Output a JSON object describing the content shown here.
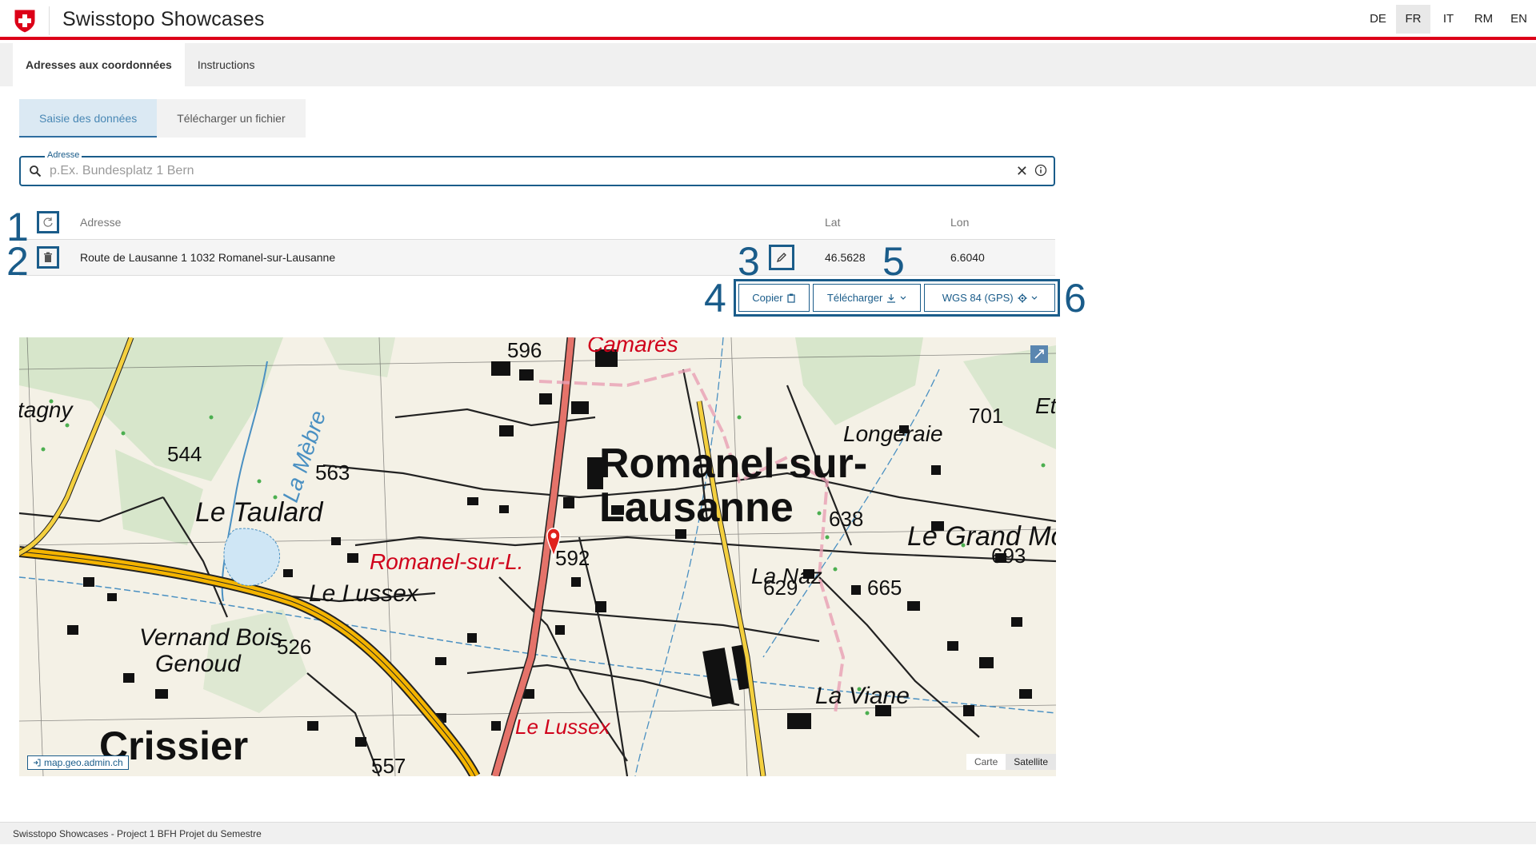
{
  "header": {
    "title": "Swisstopo Showcases",
    "languages": [
      "DE",
      "FR",
      "IT",
      "RM",
      "EN"
    ],
    "active_language": "FR"
  },
  "top_tabs": [
    {
      "label": "Adresses aux coordonnées",
      "active": true
    },
    {
      "label": "Instructions",
      "active": false
    }
  ],
  "sub_tabs": [
    {
      "label": "Saisie des données",
      "active": true
    },
    {
      "label": "Télécharger un fichier",
      "active": false
    }
  ],
  "address_field": {
    "legend": "Adresse",
    "value": "",
    "placeholder": "p.Ex. Bundesplatz 1 Bern"
  },
  "table": {
    "headers": {
      "address": "Adresse",
      "lat": "Lat",
      "lon": "Lon"
    },
    "rows": [
      {
        "address": "Route de Lausanne 1 1032 Romanel-sur-Lausanne",
        "lat": "46.5628",
        "lon": "6.6040"
      }
    ]
  },
  "annotations": [
    "1",
    "2",
    "3",
    "4",
    "5",
    "6"
  ],
  "actions": {
    "copy": "Copier",
    "download": "Télécharger",
    "crs": "WGS 84 (GPS)"
  },
  "map": {
    "attribution": "map.geo.admin.ch",
    "layers": [
      "Carte",
      "Satellite"
    ],
    "active_layer": "Satellite",
    "labels": {
      "town": "Romanel-sur-",
      "town2": "Lausanne",
      "camares": "Camarès",
      "tagny": "tagny",
      "et": "Et",
      "n701": "701",
      "n596": "596",
      "n544": "544",
      "mebre": "La Mèbre",
      "n563": "563",
      "longeraie": "Longeraie",
      "taulard": "Le Taulard",
      "n638": "638",
      "grandmont": "Le Grand Mo",
      "romanelL": "Romanel-sur-L.",
      "lussex": "Le Lussex",
      "n592": "592",
      "lanaz": "La Naz",
      "n693": "693",
      "vernand": "Vernand Bois",
      "genoud": "Genoud",
      "n629": "629",
      "n665": "665",
      "n526": "526",
      "laviane": "La Viane",
      "crissier": "Crissier",
      "lussex2": "Le Lussex",
      "n557": "557"
    },
    "colors": {
      "highway": "#f4b400",
      "main_road": "#e5736a",
      "water": "#4a90c2",
      "forest": "#cfe3c4",
      "label_red": "#d0021b"
    }
  },
  "footer": {
    "text": "Swisstopo Showcases - Project 1 BFH Projet du Semestre"
  }
}
